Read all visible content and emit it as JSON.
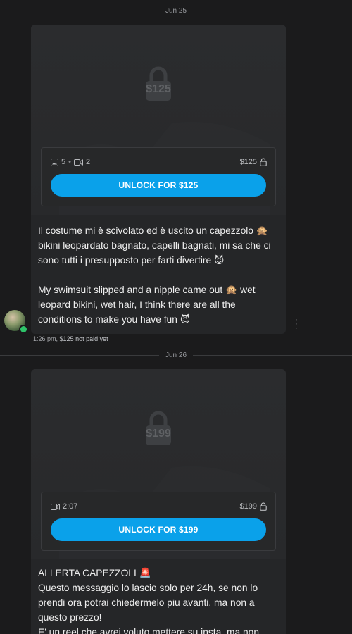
{
  "messages": [
    {
      "date": "Jun 25",
      "lock_price": "$125",
      "media_counts": {
        "photos": "5",
        "videos": "2"
      },
      "price_label": "$125",
      "unlock_label": "UNLOCK FOR $125",
      "text_it": "Il costume mi è scivolato ed è uscito un capezzolo 🙊\nbikini leopardato bagnato, capelli bagnati, mi sa che ci sono tutti i presupposto per farti divertire 😈",
      "text_en": "My swimsuit slipped and a nipple came out 🙊 wet leopard bikini, wet hair, I think there are all the conditions to make you have fun 😈",
      "time": "1:26 pm,",
      "status": "$125 not paid yet"
    },
    {
      "date": "Jun 26",
      "lock_price": "$199",
      "video_duration": "2:07",
      "price_label": "$199",
      "unlock_label": "UNLOCK FOR $199",
      "text_title": "ALLERTA CAPEZZOLI 🚨",
      "text_body": "Questo messaggio lo lascio solo per 24h, se non lo prendi ora potrai chiedermelo piu avanti, ma non a questo prezzo!\nE' un reel che avrei voluto mettere su insta, ma non"
    }
  ],
  "icons": {
    "lock": "lock-icon",
    "image": "image-icon",
    "video": "video-icon",
    "more": "more-vertical-icon"
  },
  "colors": {
    "accent": "#0aa1ea",
    "online": "#2ec46a"
  }
}
